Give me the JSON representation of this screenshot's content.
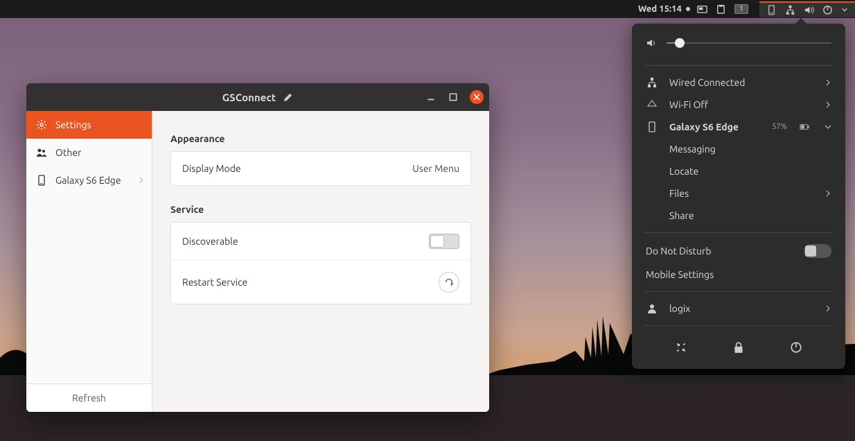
{
  "topbar": {
    "clock": "Wed 15:14",
    "workspace_badge": "1"
  },
  "system_menu": {
    "volume_percent": 10,
    "wired": {
      "label": "Wired Connected"
    },
    "wifi": {
      "label": "Wi-Fi Off"
    },
    "device": {
      "name": "Galaxy S6 Edge",
      "battery": "57%"
    },
    "device_actions": {
      "messaging": "Messaging",
      "locate": "Locate",
      "files": "Files",
      "share": "Share"
    },
    "dnd": {
      "label": "Do Not Disturb",
      "on": false
    },
    "mobile_settings": "Mobile Settings",
    "user": {
      "name": "logix"
    }
  },
  "window": {
    "title": "GSConnect",
    "sidebar": {
      "items": [
        {
          "label": "Settings",
          "icon": "gear"
        },
        {
          "label": "Other",
          "icon": "people"
        },
        {
          "label": "Galaxy S6 Edge",
          "icon": "phone"
        }
      ],
      "refresh": "Refresh"
    },
    "content": {
      "appearance": {
        "heading": "Appearance",
        "display_mode": {
          "label": "Display Mode",
          "value": "User Menu"
        }
      },
      "service": {
        "heading": "Service",
        "discoverable": {
          "label": "Discoverable",
          "on": false
        },
        "restart": {
          "label": "Restart Service"
        }
      }
    }
  }
}
